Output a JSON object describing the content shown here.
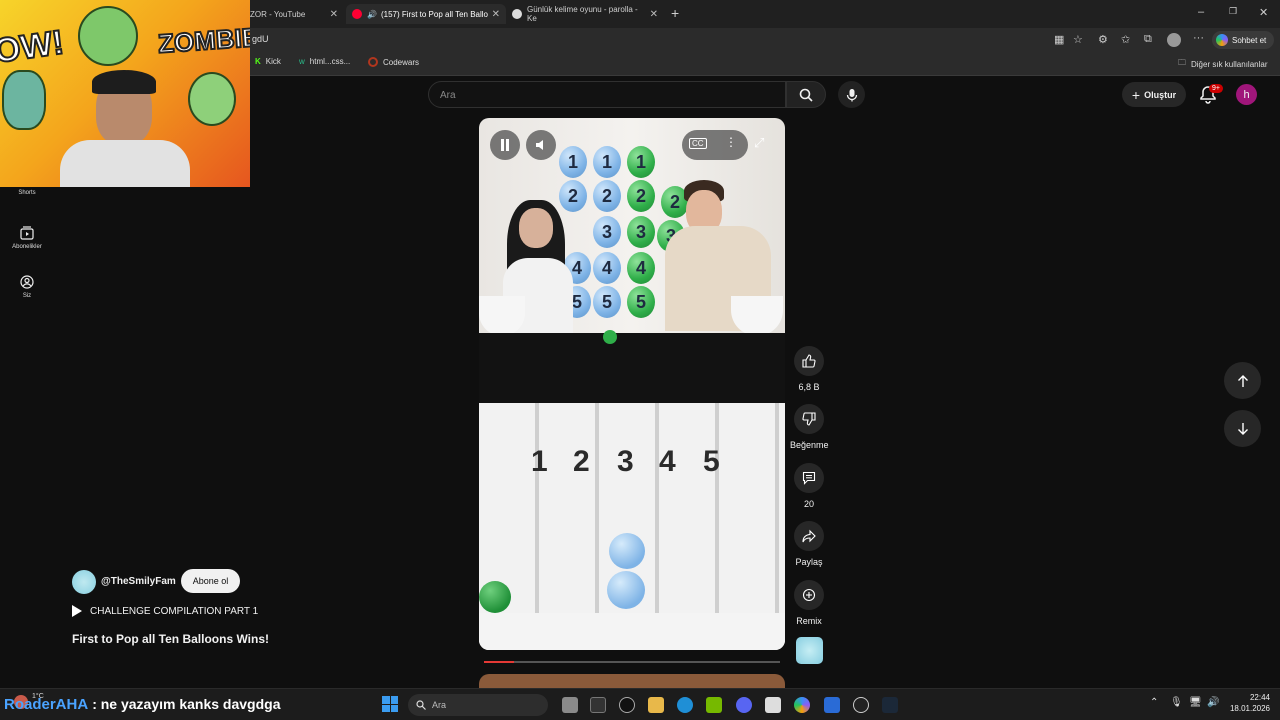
{
  "browser": {
    "tabs": [
      {
        "label": "ZOR - YouTube"
      },
      {
        "label": "(157) First to Pop all Ten Ballo"
      },
      {
        "label": "Günlük kelime oyunu - parolla - Ke"
      }
    ],
    "url": "gdU",
    "copilot_label": "Sohbet et",
    "bookmarks": [
      "Kick",
      "html...css...",
      "Codewars"
    ],
    "other_bookmarks": "Diğer sık kullanılanlar"
  },
  "youtube": {
    "search_placeholder": "Ara",
    "create_label": "Oluştur",
    "notifications_badge": "9+",
    "avatar_letter": "h",
    "sidebar": [
      {
        "label": "Shorts",
        "icon": "shorts-icon"
      },
      {
        "label": "Abonelikler",
        "icon": "subscriptions-icon"
      },
      {
        "label": "Siz",
        "icon": "you-icon"
      }
    ],
    "actions": {
      "like_count": "6,8 B",
      "dislike_label": "Beğenme",
      "comment_count": "20",
      "share_label": "Paylaş",
      "remix_label": "Remix"
    },
    "channel": "@TheSmilyFam",
    "subscribe_label": "Abone ol",
    "playlist": "CHALLENGE COMPILATION PART 1",
    "title": "First to Pop all Ten Balloons Wins!",
    "progress": 0.1
  },
  "video": {
    "lanes": [
      "1",
      "2",
      "3",
      "4",
      "5"
    ],
    "balloon_rows": [
      "1",
      "2",
      "3",
      "4",
      "5"
    ]
  },
  "webcam": {
    "text_left": "OW!",
    "text_right": "ZOMBIE!"
  },
  "overlay_chat": {
    "user": "RoaderAHA",
    "message": ": ne yazayım kanks davgdga"
  },
  "taskbar": {
    "search_placeholder": "Ara",
    "weather": "1°C",
    "time": "22:44",
    "date": "18.01.2026"
  },
  "colors": {
    "accent_red": "#cc0000",
    "avatar": "#a0167a",
    "chat_user": "#4aa3ff"
  }
}
